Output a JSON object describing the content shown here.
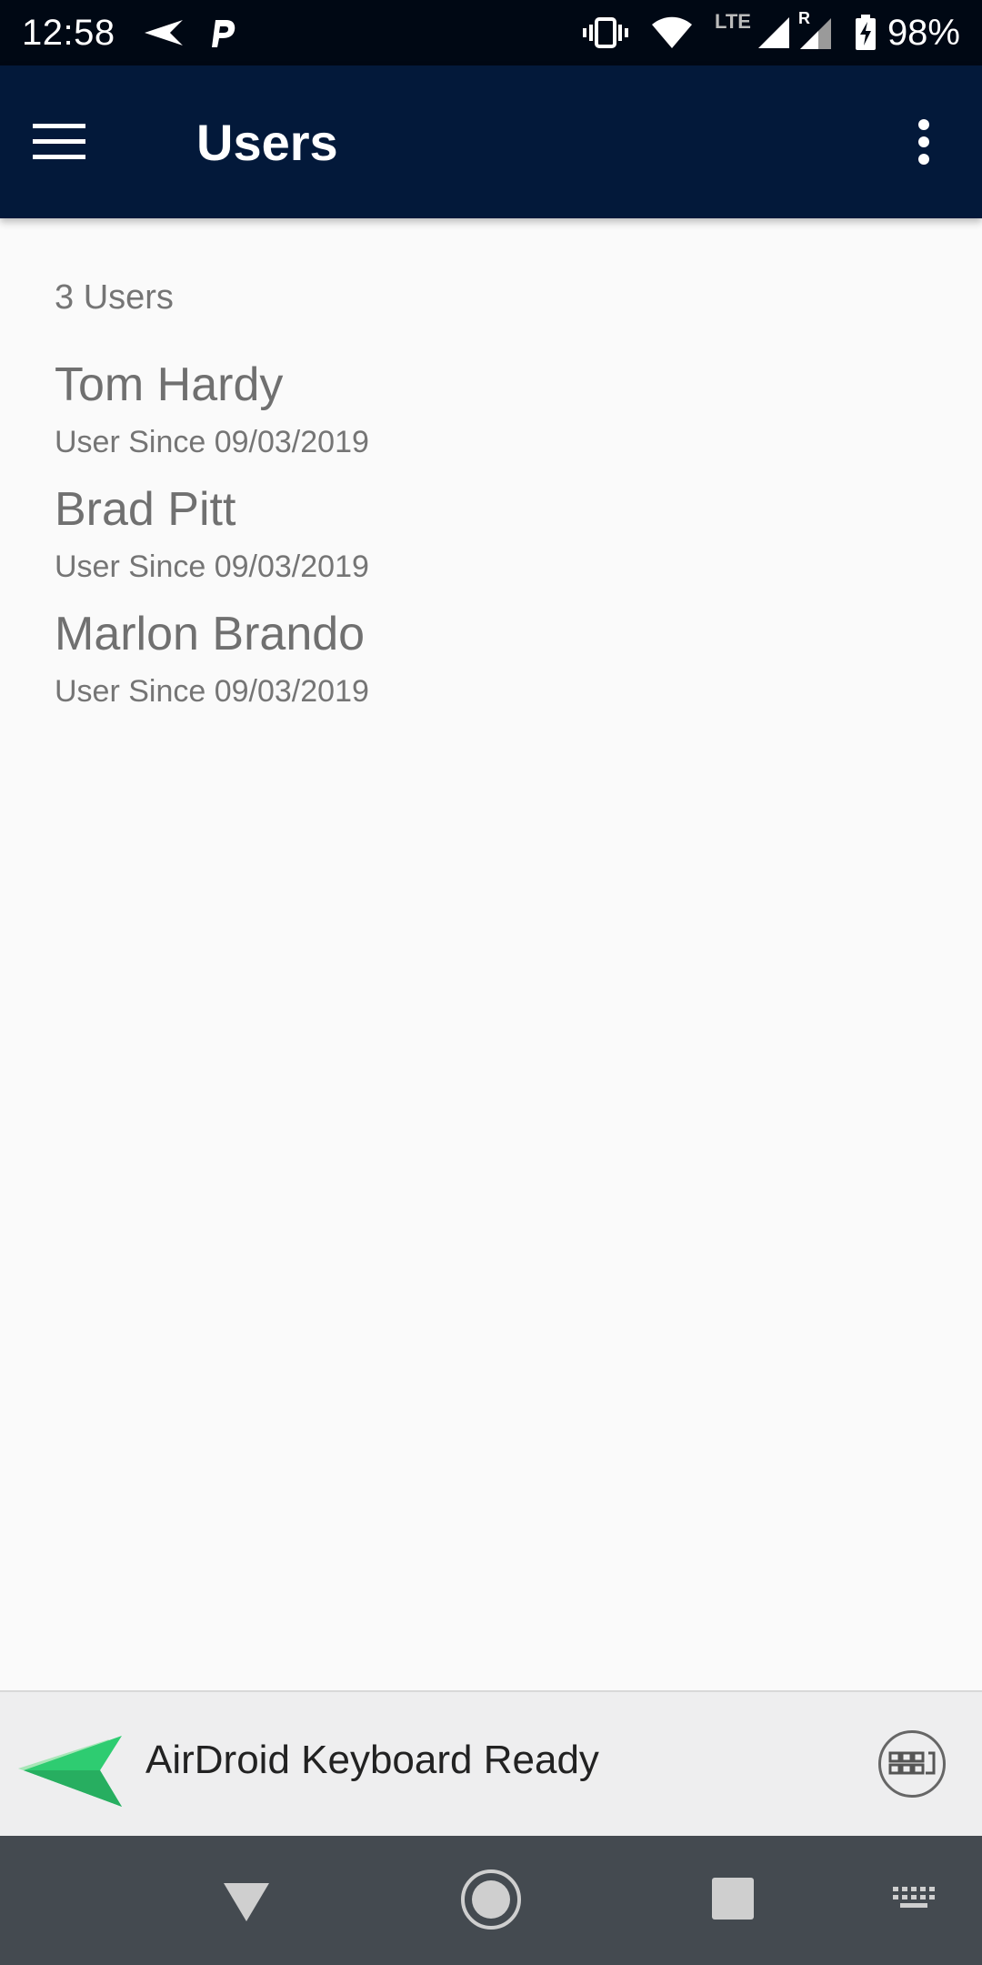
{
  "status_bar": {
    "time": "12:58",
    "battery": "98%",
    "icons": [
      "airdroid-send-icon",
      "parking-icon",
      "vibrate-icon",
      "wifi-icon",
      "lte-icon",
      "signal-icon",
      "roaming-signal-icon",
      "battery-charging-icon"
    ],
    "lte_label": "LTE",
    "roaming_label": "R"
  },
  "app_bar": {
    "title": "Users",
    "background": "#03193a",
    "icons": [
      "menu-icon",
      "more-vert-icon"
    ]
  },
  "users": {
    "count_label": "3 Users",
    "items": [
      {
        "name": "Tom Hardy",
        "since": "User Since 09/03/2019"
      },
      {
        "name": "Brad Pitt",
        "since": "User Since 09/03/2019"
      },
      {
        "name": "Marlon Brando",
        "since": "User Since 09/03/2019"
      }
    ]
  },
  "keyboard_banner": {
    "text": "AirDroid Keyboard Ready",
    "logo_color": "#2ecc71",
    "icons": [
      "airdroid-logo-icon",
      "keyboard-toggle-icon"
    ]
  },
  "nav_bar": {
    "icons": [
      "back-icon",
      "home-icon",
      "recents-icon",
      "keyboard-icon"
    ]
  }
}
